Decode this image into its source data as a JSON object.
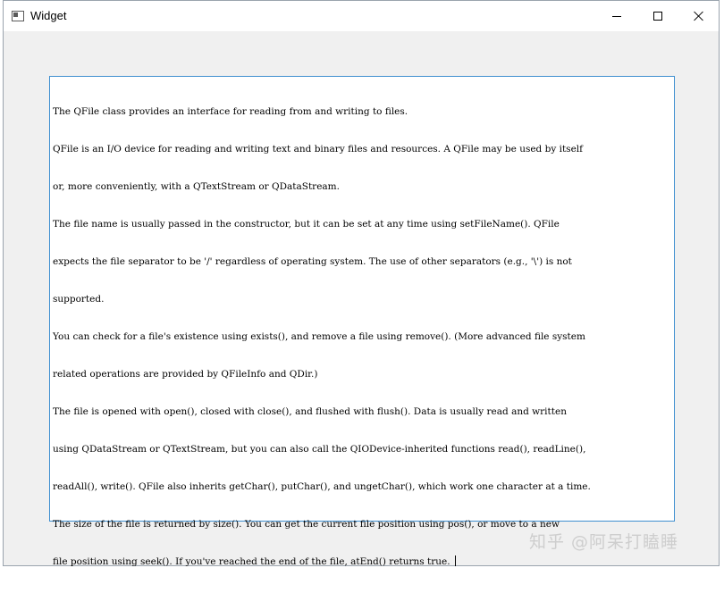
{
  "window": {
    "title": "Widget",
    "icon": "app-window-icon",
    "controls": [
      "minimize-icon",
      "maximize-icon",
      "close-icon"
    ]
  },
  "editor": {
    "lines": [
      "The QFile class provides an interface for reading from and writing to files.",
      "QFile is an I/O device for reading and writing text and binary files and resources. A QFile may be used by itself",
      "or, more conveniently, with a QTextStream or QDataStream.",
      "The file name is usually passed in the constructor, but it can be set at any time using setFileName(). QFile",
      "expects the file separator to be '/' regardless of operating system. The use of other separators (e.g., '\\') is not",
      "supported.",
      "You can check for a file's existence using exists(), and remove a file using remove(). (More advanced file system",
      "related operations are provided by QFileInfo and QDir.)",
      "The file is opened with open(), closed with close(), and flushed with flush(). Data is usually read and written",
      "using QDataStream or QTextStream, but you can also call the QIODevice-inherited functions read(), readLine(),",
      "readAll(), write(). QFile also inherits getChar(), putChar(), and ungetChar(), which work one character at a time.",
      "The size of the file is returned by size(). You can get the current file position using pos(), or move to a new",
      "file position using seek(). If you've reached the end of the file, atEnd() returns true. "
    ]
  },
  "watermark": {
    "text": "知乎 @阿呆打瞌睡"
  },
  "colors": {
    "window_bg": "#f0f0f0",
    "titlebar_bg": "#ffffff",
    "editor_border": "#3f8fd0",
    "text": "#000000"
  }
}
